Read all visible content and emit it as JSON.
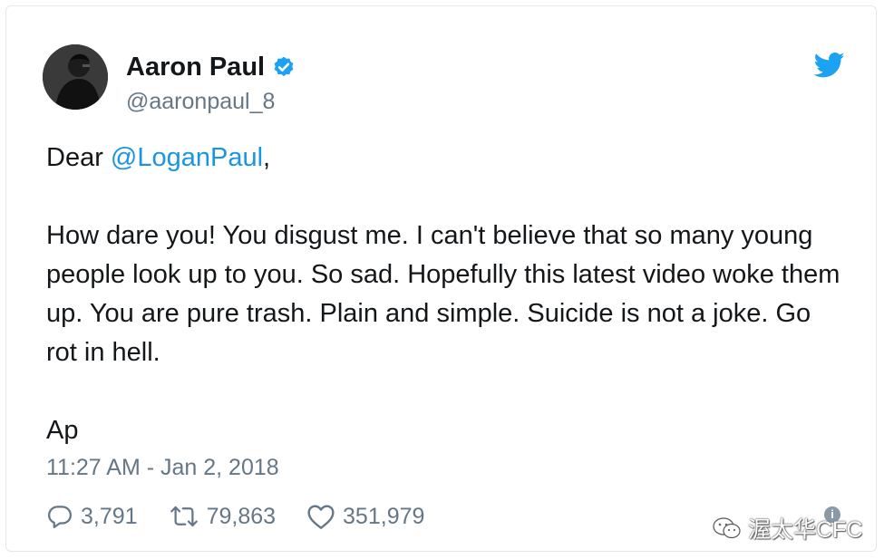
{
  "author": {
    "display_name": "Aaron Paul",
    "handle": "@aaronpaul_8",
    "verified": true
  },
  "tweet": {
    "greeting_prefix": "Dear ",
    "mention": "@LoganPaul",
    "greeting_suffix": ",",
    "body": "How dare you! You disgust me. I can't believe that so many young people look up to you. So sad. Hopefully this latest video woke them up. You are pure trash. Plain and simple. Suicide is not a joke. Go rot in hell.",
    "signature": "Ap",
    "timestamp": "11:27 AM - Jan 2, 2018"
  },
  "actions": {
    "replies": "3,791",
    "retweets": "79,863",
    "likes": "351,979"
  },
  "watermark": {
    "text": "渥太华CFC"
  },
  "icons": {
    "platform": "twitter-bird-icon",
    "verified": "verified-badge-icon",
    "reply": "reply-icon",
    "retweet": "retweet-icon",
    "like": "heart-icon",
    "watermark": "wechat-icon"
  },
  "colors": {
    "brand": "#1da1f2",
    "mention": "#1b95e0",
    "text": "#14171a",
    "muted": "#657786"
  }
}
